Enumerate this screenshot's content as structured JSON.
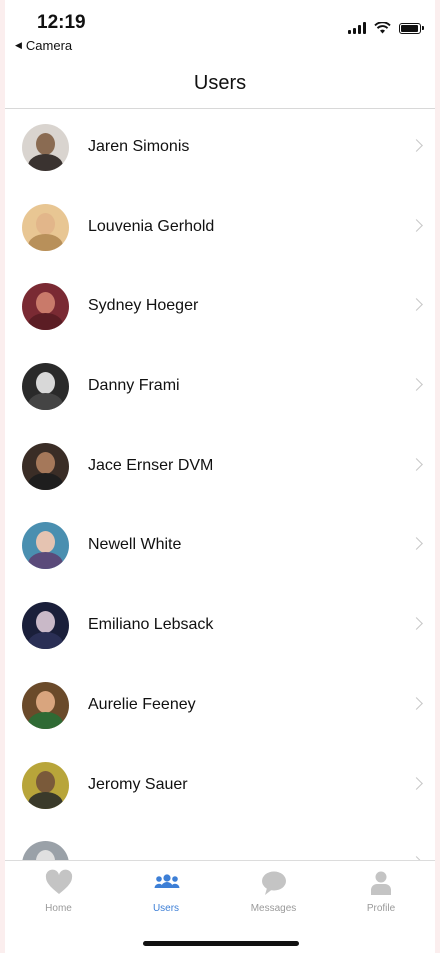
{
  "status_bar": {
    "time": "12:19",
    "back_app": "Camera"
  },
  "navbar": {
    "title": "Users"
  },
  "users": [
    {
      "name": "Jaren Simonis",
      "avatar_bg": "#d9d4cf",
      "skin": "#8a6b52",
      "shirt": "#3a3330"
    },
    {
      "name": "Louvenia Gerhold",
      "avatar_bg": "#e8c693",
      "skin": "#e2b68a",
      "shirt": "#b8905a"
    },
    {
      "name": "Sydney Hoeger",
      "avatar_bg": "#7a2a33",
      "skin": "#c97a6a",
      "shirt": "#5b1d24"
    },
    {
      "name": "Danny Frami",
      "avatar_bg": "#2a2a2a",
      "skin": "#d8d8d8",
      "shirt": "#444444"
    },
    {
      "name": "Jace Ernser DVM",
      "avatar_bg": "#3a2d26",
      "skin": "#a5785a",
      "shirt": "#1e1e1e"
    },
    {
      "name": "Newell White",
      "avatar_bg": "#4a8fb0",
      "skin": "#e5c3b1",
      "shirt": "#5a4a7a"
    },
    {
      "name": "Emiliano Lebsack",
      "avatar_bg": "#1a1f3a",
      "skin": "#c9b9c8",
      "shirt": "#2a2f55"
    },
    {
      "name": "Aurelie Feeney",
      "avatar_bg": "#6a4a2a",
      "skin": "#d9a57e",
      "shirt": "#2f6a34"
    },
    {
      "name": "Jeromy Sauer",
      "avatar_bg": "#b8a53a",
      "skin": "#7a5a3a",
      "shirt": "#3a3a2a"
    },
    {
      "name": "",
      "avatar_bg": "#9aa1a8",
      "skin": "#e0e0e0",
      "shirt": "#4a4a4a"
    }
  ],
  "tabs": [
    {
      "label": "Home",
      "icon": "heart-icon",
      "active": false
    },
    {
      "label": "Users",
      "icon": "users-icon",
      "active": true
    },
    {
      "label": "Messages",
      "icon": "chat-bubble-icon",
      "active": false
    },
    {
      "label": "Profile",
      "icon": "person-icon",
      "active": false
    }
  ],
  "colors": {
    "accent": "#3d7fd6",
    "inactive": "#9a9a9a"
  }
}
